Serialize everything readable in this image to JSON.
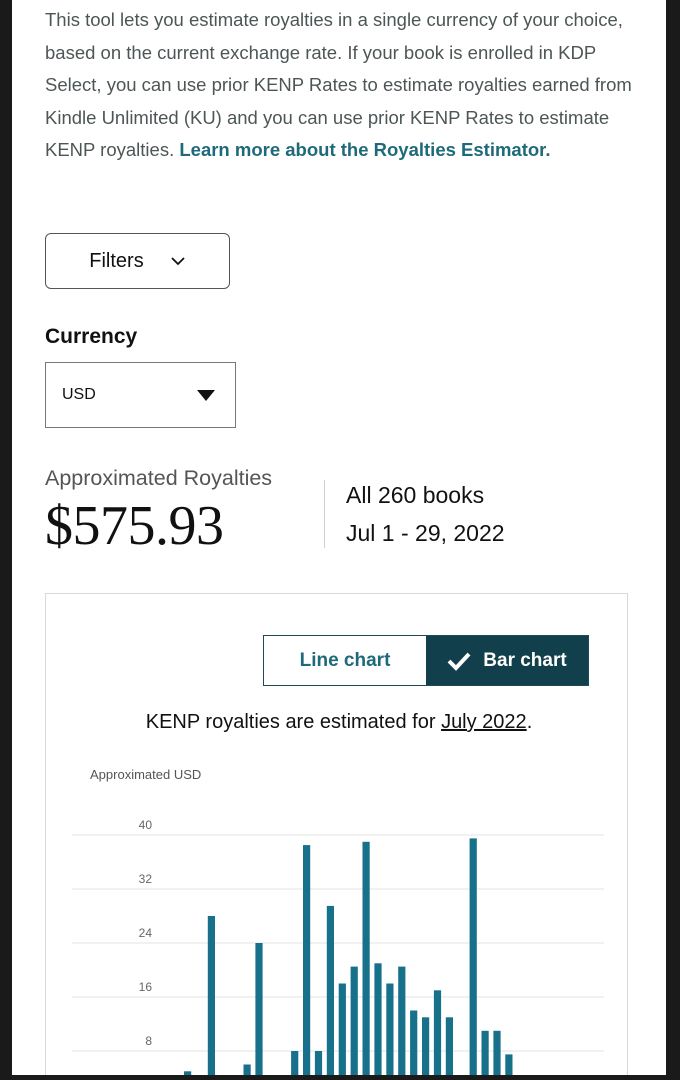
{
  "intro": {
    "text": "This tool lets you estimate royalties in a single currency of your choice, based on the current exchange rate. If your book is enrolled in KDP Select, you can use prior KENP Rates to estimate royalties earned from Kindle Unlimited (KU) and you can use prior KENP Rates to estimate KENP royalties.",
    "link": "Learn more about the Royalties Estimator."
  },
  "filters": {
    "label": "Filters",
    "icon": "chevron-down-icon"
  },
  "currency": {
    "label": "Currency",
    "value": "USD",
    "icon": "caret-down-icon"
  },
  "summary": {
    "label": "Approximated Royalties",
    "value": "$575.93",
    "books": "All 260 books",
    "dates": "Jul 1 - 29, 2022"
  },
  "chart_toggle": {
    "line_label": "Line chart",
    "bar_label": "Bar chart",
    "selected": "Bar chart",
    "check_icon": "checkmark-icon"
  },
  "note": {
    "prefix": "KENP royalties are estimated for ",
    "month": "July 2022",
    "suffix": "."
  },
  "colors": {
    "accent": "#1e6a7a",
    "bar": "#17718a",
    "toggle_dark": "#123f4c"
  },
  "chart_data": {
    "type": "bar",
    "ylabel": "Approximated USD",
    "yticks": [
      40,
      32,
      24,
      16,
      8
    ],
    "ylim": [
      0,
      40
    ],
    "grid": true,
    "values": [
      5,
      3,
      28,
      0,
      2,
      6,
      24,
      2,
      3,
      8,
      38.5,
      8,
      29.5,
      18,
      20.5,
      39,
      21,
      18,
      20.5,
      14,
      13,
      17,
      13,
      0.5,
      39.5,
      11,
      11,
      7.5
    ]
  }
}
